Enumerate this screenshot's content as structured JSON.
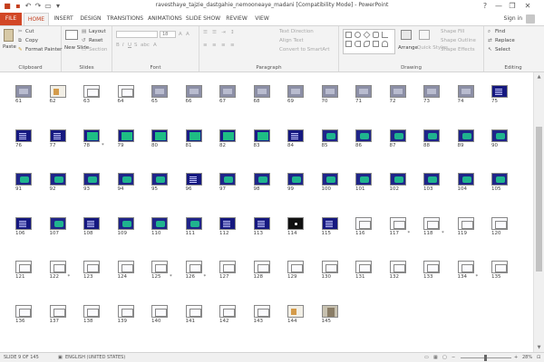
{
  "window": {
    "title": "ravesthaye_tajzie_dastgahie_nemooneaye_madani [Compatibility Mode] - PowerPoint",
    "help": "?",
    "minimize": "—",
    "restore": "❐",
    "close": "✕"
  },
  "tabs": [
    "FILE",
    "HOME",
    "INSERT",
    "DESIGN",
    "TRANSITIONS",
    "ANIMATIONS",
    "SLIDE SHOW",
    "REVIEW",
    "VIEW"
  ],
  "active_tab": "HOME",
  "account": {
    "signin": "Sign in"
  },
  "ribbon": {
    "clipboard": {
      "label": "Clipboard",
      "paste": "Paste",
      "cut": "Cut",
      "copy": "Copy",
      "format_painter": "Format Painter"
    },
    "slides": {
      "label": "Slides",
      "new_slide": "New Slide",
      "layout": "Layout",
      "reset": "Reset",
      "section": "Section"
    },
    "font": {
      "label": "Font",
      "font_size": "18"
    },
    "paragraph": {
      "label": "Paragraph",
      "text_direction": "Text Direction",
      "align_text": "Align Text",
      "convert_smartart": "Convert to SmartArt"
    },
    "drawing": {
      "label": "Drawing",
      "arrange": "Arrange",
      "quick_styles": "Quick Styles",
      "shape_fill": "Shape Fill",
      "shape_outline": "Shape Outline",
      "shape_effects": "Shape Effects"
    },
    "editing": {
      "label": "Editing",
      "find": "Find",
      "replace": "Replace",
      "select": "Select"
    }
  },
  "slides": [
    {
      "n": "61",
      "k": "gray",
      "s": ""
    },
    {
      "n": "62",
      "k": "mixed",
      "s": ""
    },
    {
      "n": "63",
      "k": "white",
      "s": ""
    },
    {
      "n": "64",
      "k": "white",
      "s": ""
    },
    {
      "n": "65",
      "k": "gray",
      "s": ""
    },
    {
      "n": "66",
      "k": "gray",
      "s": ""
    },
    {
      "n": "67",
      "k": "gray",
      "s": ""
    },
    {
      "n": "68",
      "k": "gray",
      "s": ""
    },
    {
      "n": "69",
      "k": "gray",
      "s": ""
    },
    {
      "n": "70",
      "k": "gray",
      "s": ""
    },
    {
      "n": "71",
      "k": "gray",
      "s": ""
    },
    {
      "n": "72",
      "k": "gray",
      "s": ""
    },
    {
      "n": "73",
      "k": "gray",
      "s": ""
    },
    {
      "n": "74",
      "k": "gray",
      "s": ""
    },
    {
      "n": "75",
      "k": "blue",
      "s": ""
    },
    {
      "n": "76",
      "k": "blue",
      "s": ""
    },
    {
      "n": "77",
      "k": "blue",
      "s": ""
    },
    {
      "n": "78",
      "k": "diamond",
      "s": "*"
    },
    {
      "n": "79",
      "k": "diamond",
      "s": ""
    },
    {
      "n": "80",
      "k": "diamond",
      "s": ""
    },
    {
      "n": "81",
      "k": "diamond",
      "s": ""
    },
    {
      "n": "82",
      "k": "diamond",
      "s": ""
    },
    {
      "n": "83",
      "k": "diamond",
      "s": ""
    },
    {
      "n": "84",
      "k": "blue",
      "s": ""
    },
    {
      "n": "85",
      "k": "teal",
      "s": ""
    },
    {
      "n": "86",
      "k": "teal",
      "s": ""
    },
    {
      "n": "87",
      "k": "teal",
      "s": ""
    },
    {
      "n": "88",
      "k": "teal",
      "s": ""
    },
    {
      "n": "89",
      "k": "teal",
      "s": ""
    },
    {
      "n": "90",
      "k": "teal",
      "s": ""
    },
    {
      "n": "91",
      "k": "teal",
      "s": ""
    },
    {
      "n": "92",
      "k": "teal",
      "s": ""
    },
    {
      "n": "93",
      "k": "teal",
      "s": ""
    },
    {
      "n": "94",
      "k": "teal",
      "s": ""
    },
    {
      "n": "95",
      "k": "teal",
      "s": ""
    },
    {
      "n": "96",
      "k": "blue",
      "s": ""
    },
    {
      "n": "97",
      "k": "teal",
      "s": ""
    },
    {
      "n": "98",
      "k": "teal",
      "s": ""
    },
    {
      "n": "99",
      "k": "teal",
      "s": ""
    },
    {
      "n": "100",
      "k": "teal",
      "s": ""
    },
    {
      "n": "101",
      "k": "teal",
      "s": ""
    },
    {
      "n": "102",
      "k": "teal",
      "s": ""
    },
    {
      "n": "103",
      "k": "teal",
      "s": ""
    },
    {
      "n": "104",
      "k": "teal",
      "s": ""
    },
    {
      "n": "105",
      "k": "teal",
      "s": ""
    },
    {
      "n": "106",
      "k": "blue",
      "s": ""
    },
    {
      "n": "107",
      "k": "teal",
      "s": ""
    },
    {
      "n": "108",
      "k": "blue",
      "s": ""
    },
    {
      "n": "109",
      "k": "teal",
      "s": ""
    },
    {
      "n": "110",
      "k": "teal",
      "s": ""
    },
    {
      "n": "111",
      "k": "teal",
      "s": ""
    },
    {
      "n": "112",
      "k": "blue",
      "s": ""
    },
    {
      "n": "113",
      "k": "blue",
      "s": ""
    },
    {
      "n": "114",
      "k": "black",
      "s": ""
    },
    {
      "n": "115",
      "k": "blue",
      "s": ""
    },
    {
      "n": "116",
      "k": "white",
      "s": ""
    },
    {
      "n": "117",
      "k": "white",
      "s": "*"
    },
    {
      "n": "118",
      "k": "white",
      "s": "*"
    },
    {
      "n": "119",
      "k": "white",
      "s": ""
    },
    {
      "n": "120",
      "k": "white",
      "s": ""
    },
    {
      "n": "121",
      "k": "white",
      "s": ""
    },
    {
      "n": "122",
      "k": "white",
      "s": "*"
    },
    {
      "n": "123",
      "k": "white",
      "s": ""
    },
    {
      "n": "124",
      "k": "white",
      "s": ""
    },
    {
      "n": "125",
      "k": "white",
      "s": "*"
    },
    {
      "n": "126",
      "k": "white",
      "s": "*"
    },
    {
      "n": "127",
      "k": "white",
      "s": ""
    },
    {
      "n": "128",
      "k": "white",
      "s": ""
    },
    {
      "n": "129",
      "k": "white",
      "s": ""
    },
    {
      "n": "130",
      "k": "white",
      "s": ""
    },
    {
      "n": "131",
      "k": "white",
      "s": ""
    },
    {
      "n": "132",
      "k": "white",
      "s": ""
    },
    {
      "n": "133",
      "k": "white",
      "s": ""
    },
    {
      "n": "134",
      "k": "white",
      "s": "*"
    },
    {
      "n": "135",
      "k": "white",
      "s": ""
    },
    {
      "n": "136",
      "k": "white",
      "s": ""
    },
    {
      "n": "137",
      "k": "white",
      "s": ""
    },
    {
      "n": "138",
      "k": "white",
      "s": ""
    },
    {
      "n": "139",
      "k": "white",
      "s": ""
    },
    {
      "n": "140",
      "k": "white",
      "s": ""
    },
    {
      "n": "141",
      "k": "white",
      "s": ""
    },
    {
      "n": "142",
      "k": "white",
      "s": ""
    },
    {
      "n": "143",
      "k": "white",
      "s": ""
    },
    {
      "n": "144",
      "k": "mixed",
      "s": ""
    },
    {
      "n": "145",
      "k": "photo",
      "s": ""
    }
  ],
  "status": {
    "slide_position": "SLIDE 9 OF 145",
    "language": "ENGLISH (UNITED STATES)",
    "zoom": "28%",
    "zoom_fraction": 0.28
  },
  "colors": {
    "accent": "#d24726",
    "tab_text": "#c43e1c",
    "slide_blue": "#15187f",
    "slide_teal": "#1fb48e"
  }
}
